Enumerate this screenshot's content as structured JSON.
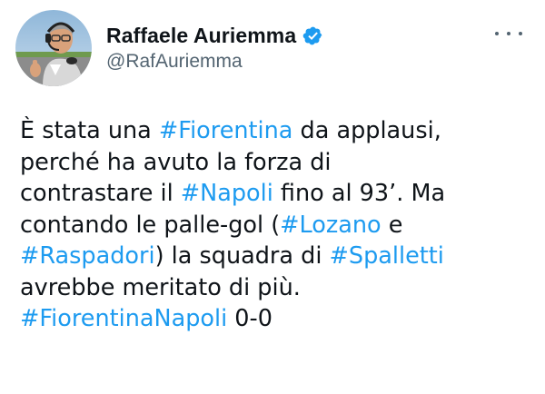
{
  "user": {
    "display_name": "Raffaele Auriemma",
    "handle": "@RafAuriemma",
    "verified": true,
    "verified_icon": "verified-badge-icon",
    "avatar_icon": "avatar-photo"
  },
  "more_icon": "more-options-icon",
  "colors": {
    "link": "#1d9bf0",
    "text": "#0f1419",
    "secondary": "#536471"
  },
  "tweet": {
    "lines": [
      [
        {
          "t": "È stata una "
        },
        {
          "t": "#Fiorentina",
          "tag": true
        },
        {
          "t": " da applausi,"
        }
      ],
      [
        {
          "t": "perché ha avuto la forza di"
        }
      ],
      [
        {
          "t": "contrastare il "
        },
        {
          "t": "#Napoli",
          "tag": true
        },
        {
          "t": " fino al 93’. Ma"
        }
      ],
      [
        {
          "t": "contando le palle-gol ("
        },
        {
          "t": "#Lozano",
          "tag": true
        },
        {
          "t": " e"
        }
      ],
      [
        {
          "t": "#Raspadori",
          "tag": true
        },
        {
          "t": ") la squadra di "
        },
        {
          "t": "#Spalletti",
          "tag": true
        }
      ],
      [
        {
          "t": "avrebbe meritato di più."
        }
      ],
      [
        {
          "t": "#FiorentinaNapoli",
          "tag": true
        },
        {
          "t": " 0-0"
        }
      ]
    ]
  }
}
